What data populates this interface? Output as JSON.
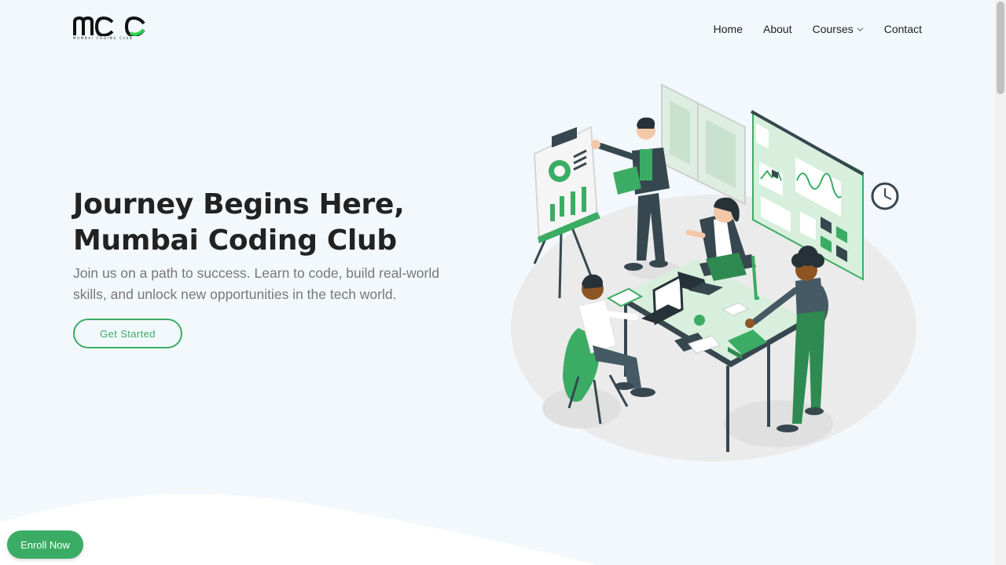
{
  "header": {
    "logo_text": "mcc",
    "logo_subtext": "MUMBAI CODING CLUB",
    "nav": [
      {
        "label": "Home"
      },
      {
        "label": "About"
      },
      {
        "label": "Courses",
        "has_dropdown": true
      },
      {
        "label": "Contact"
      }
    ]
  },
  "hero": {
    "title_line1": "Journey Begins Here,",
    "title_line2": "Mumbai Coding Club",
    "subtitle": "Join us on a path to success. Learn to code, build real-world skills, and unlock new opportunities in the tech world.",
    "cta_label": "Get Started"
  },
  "floating": {
    "enroll_label": "Enroll Now"
  },
  "colors": {
    "accent": "#3bac64",
    "background": "#f3f8fd",
    "text": "#222222",
    "muted": "#777777"
  }
}
